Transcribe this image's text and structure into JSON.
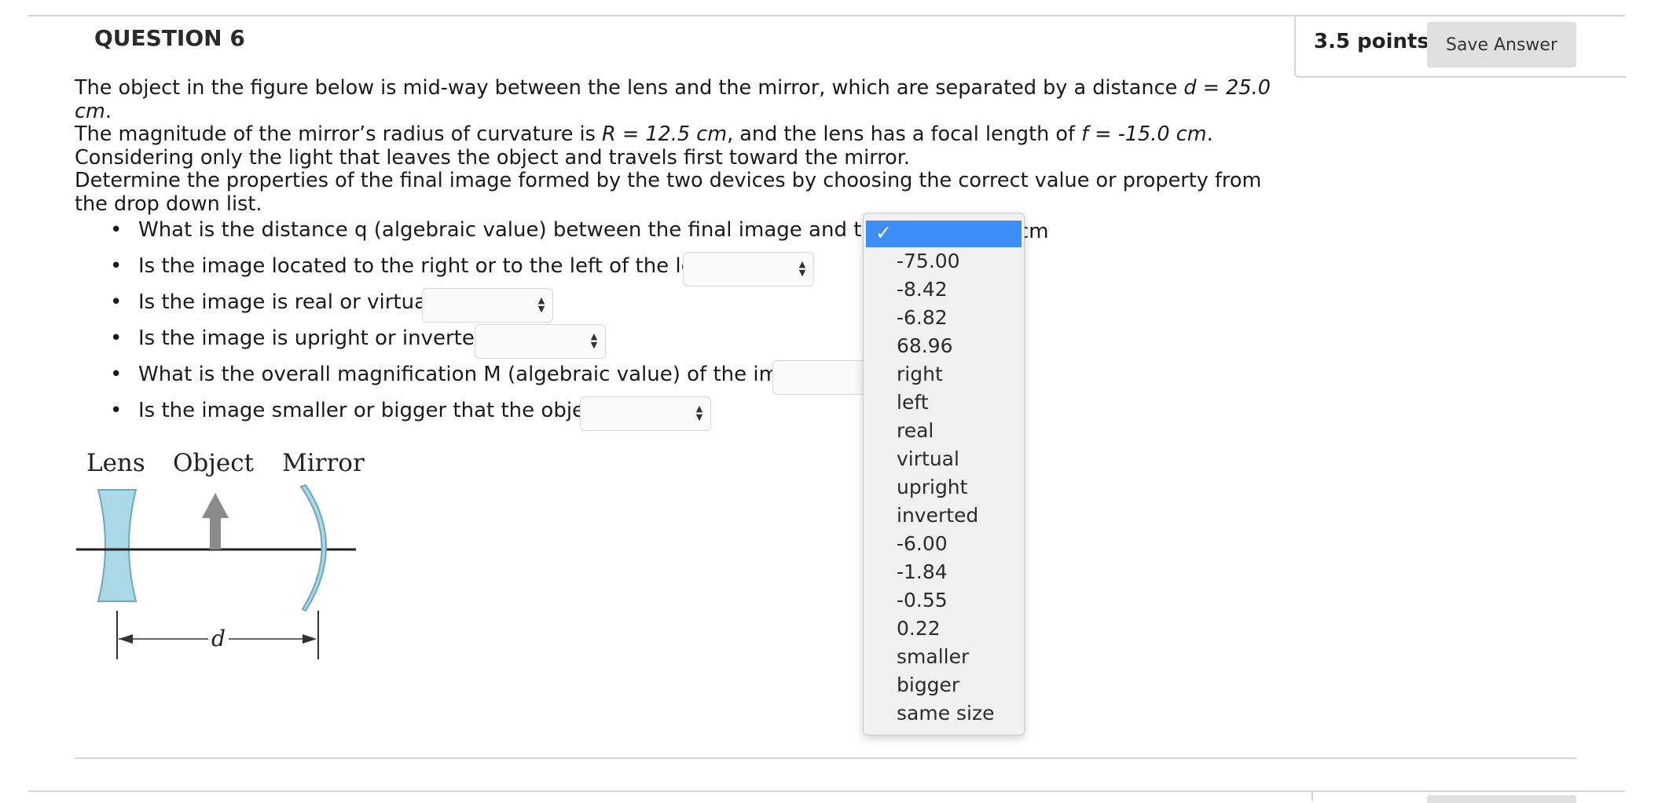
{
  "question": {
    "header": "QUESTION 6",
    "points": "3.5 points",
    "save_label": "Save Answer"
  },
  "prompt": {
    "line1_a": "The object in the figure below is mid-way between the lens and the mirror, which are separated by a distance ",
    "line1_var": "d = 25.0 cm",
    "line1_end": ".",
    "line2_a": "The magnitude of the mirror’s radius of curvature is ",
    "line2_R": "R = 12.5 cm",
    "line2_b": ", and the lens has a focal length of ",
    "line2_f": "f = -15.0 cm",
    "line2_end": ".",
    "line3": "Considering only the light that leaves the object and travels first toward the mirror.",
    "line4": "Determine the properties of the final image formed by the two devices by choosing the correct value or property from the drop down list."
  },
  "questions": [
    {
      "text": "What is the distance q (algebraic value) between the final image and the lens",
      "unit_fragment": "cm"
    },
    {
      "text": "Is the image located to the right or to the left of the lens?"
    },
    {
      "text": "Is the image is real or virtual?"
    },
    {
      "text": "Is the image is upright or inverted?"
    },
    {
      "text": "What is the overall magnification M (algebraic value) of the image?"
    },
    {
      "text": "Is the image smaller or bigger that the object?"
    }
  ],
  "dropdown": {
    "selected_mark": "✓",
    "options": [
      "-75.00",
      "-8.42",
      "-6.82",
      "68.96",
      "right",
      "left",
      "real",
      "virtual",
      "upright",
      "inverted",
      "-6.00",
      "-1.84",
      "-0.55",
      "0.22",
      "smaller",
      "bigger",
      "same size"
    ]
  },
  "figure": {
    "lens_label": "Lens",
    "object_label": "Object",
    "mirror_label": "Mirror",
    "distance_label": "d",
    "glass_color": "#a9d8e6",
    "arrow_color": "#8a8a8a"
  },
  "colors": {
    "accent": "#3d8ef7",
    "button_bg": "#e0e0e0",
    "rule": "#d4d4d4"
  }
}
